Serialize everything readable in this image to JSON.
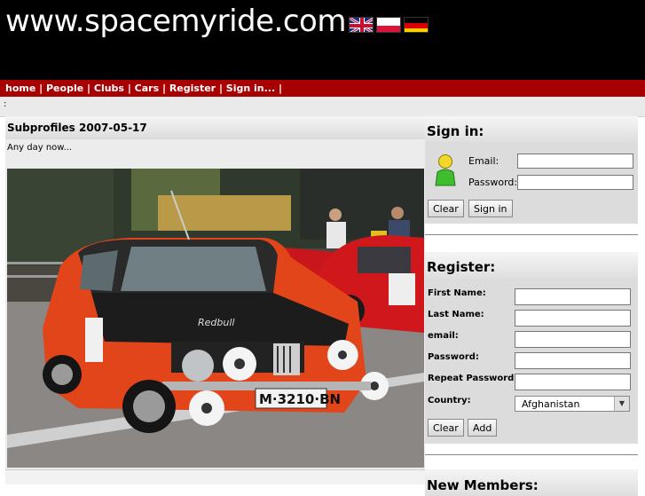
{
  "header": {
    "site_title": "www.spacemyride.com",
    "flags": [
      {
        "name": "english-flag-icon"
      },
      {
        "name": "polish-flag-icon"
      },
      {
        "name": "german-flag-icon"
      }
    ]
  },
  "nav": {
    "items": [
      "home",
      "People",
      "Clubs",
      "Cars",
      "Register",
      "Sign in..."
    ],
    "separator": " | ",
    "trailing": " |"
  },
  "subbar": {
    "mark": ":"
  },
  "article": {
    "title": "Subprofiles 2007-05-17",
    "text": "Any day now...",
    "photo": {
      "plate": "M·3210·BN",
      "car_brand_text": "Redbull",
      "icon": "rally-car-photo"
    }
  },
  "signin": {
    "title": "Sign in:",
    "email_label": "Email:",
    "password_label": "Password:",
    "email_value": "",
    "password_value": "",
    "clear_label": "Clear",
    "submit_label": "Sign in"
  },
  "register": {
    "title": "Register:",
    "first_name_label": "First Name:",
    "last_name_label": "Last Name:",
    "email_label": "email:",
    "password_label": "Password:",
    "repeat_password_label": "Repeat Password:",
    "country_label": "Country:",
    "country_value": "Afghanistan",
    "clear_label": "Clear",
    "add_label": "Add"
  },
  "new_members": {
    "title": "New Members:"
  },
  "colors": {
    "header_bg": "#000000",
    "nav_bg": "#a80000",
    "panel_bg": "#dcdcdc"
  }
}
